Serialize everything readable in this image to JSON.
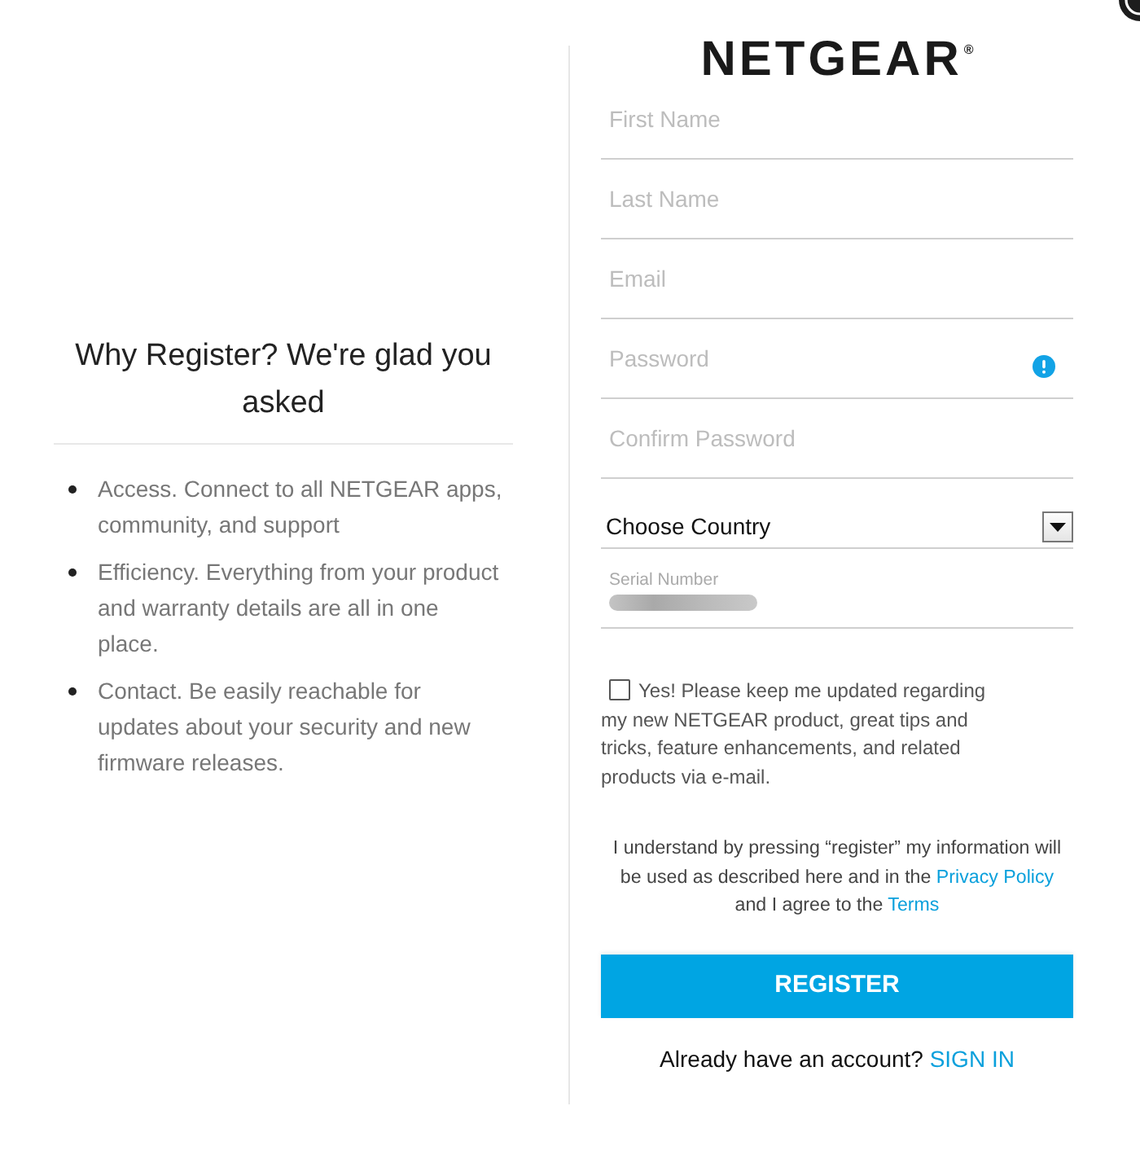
{
  "intro": {
    "heading": "Why Register? We're glad you asked",
    "benefits": [
      "Access. Connect to all NETGEAR apps, community, and support",
      "Efficiency. Everything from your product and warranty details are all in one place.",
      "Contact. Be easily reachable for updates about your security and new firmware releases."
    ]
  },
  "logo": {
    "text": "NETGEAR",
    "mark": "®"
  },
  "form": {
    "fields": [
      {
        "kind": "input",
        "placeholder": "First Name"
      },
      {
        "kind": "input",
        "placeholder": "Last Name"
      },
      {
        "kind": "input",
        "placeholder": "Email"
      },
      {
        "kind": "input",
        "placeholder": "Password",
        "info_icon": true
      },
      {
        "kind": "input",
        "placeholder": "Confirm Password"
      },
      {
        "kind": "select",
        "value": "Choose Country"
      },
      {
        "kind": "floating",
        "label": "Serial Number",
        "value_obscured": true
      }
    ],
    "newsletter": {
      "checked": false,
      "text": "Yes! Please keep me updated regarding my new NETGEAR product, great tips and tricks, feature enhancements, and related products via e-mail."
    },
    "consent": [
      {
        "kind": "text",
        "text": "I understand by pressing “register” my information will be used as described here and in the "
      },
      {
        "kind": "link",
        "text": "Privacy Policy"
      },
      {
        "kind": "text",
        "text": " and I agree to the "
      },
      {
        "kind": "link",
        "text": "Terms"
      }
    ],
    "register_button": "REGISTER",
    "signin": {
      "prompt": "Already have an account?",
      "link": "SIGN IN"
    }
  }
}
